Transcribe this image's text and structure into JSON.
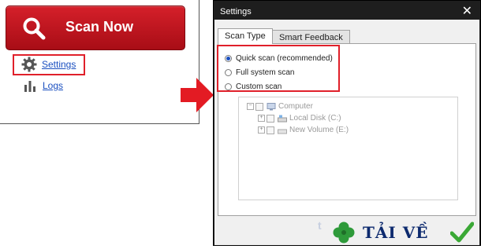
{
  "left_panel": {
    "scan_button_label": "Scan Now",
    "settings_label": "Settings",
    "logs_label": "Logs"
  },
  "dialog": {
    "title": "Settings",
    "close_glyph": "✕",
    "tabs": [
      {
        "label": "Scan Type",
        "active": true
      },
      {
        "label": "Smart Feedback",
        "active": false
      }
    ],
    "scan_options": [
      {
        "label": "Quick scan (recommended)",
        "selected": true
      },
      {
        "label": "Full system scan",
        "selected": false
      },
      {
        "label": "Custom scan",
        "selected": false
      }
    ],
    "tree": {
      "root": "Computer",
      "children": [
        "Local Disk (C:)",
        "New Volume (E:)"
      ]
    }
  },
  "watermark": {
    "text": "TẢI VỀ"
  },
  "colors": {
    "scan_red": "#c8141e",
    "highlight_red": "#e0202a",
    "link_blue": "#1a4fc0",
    "watermark_navy": "#0d2a6e",
    "check_green": "#3aa835"
  },
  "icons": {
    "scan": "magnifier-icon",
    "settings": "gear-icon",
    "logs": "bar-chart-icon",
    "arrow": "right-arrow-icon",
    "watermark_logo": "clover-icon",
    "watermark_check": "checkmark-icon"
  }
}
